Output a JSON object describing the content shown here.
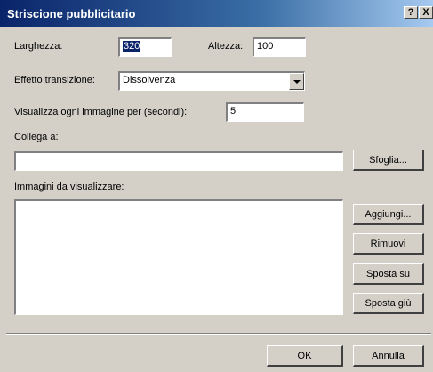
{
  "window": {
    "title": "Striscione pubblicitario",
    "help_button": "?",
    "close_button": "X"
  },
  "form": {
    "width_label": "Larghezza:",
    "width_value": "320",
    "height_label": "Altezza:",
    "height_value": "100",
    "transition_label": "Effetto transizione:",
    "transition_value": "Dissolvenza",
    "duration_label": "Visualizza ogni immagine per (secondi):",
    "duration_value": "5",
    "link_label": "Collega a:",
    "link_value": "",
    "images_label": "Immagini da visualizzare:"
  },
  "buttons": {
    "browse": "Sfoglia...",
    "add": "Aggiungi...",
    "remove": "Rimuovi",
    "move_up": "Sposta su",
    "move_down": "Sposta giù",
    "ok": "OK",
    "cancel": "Annulla"
  },
  "images": []
}
